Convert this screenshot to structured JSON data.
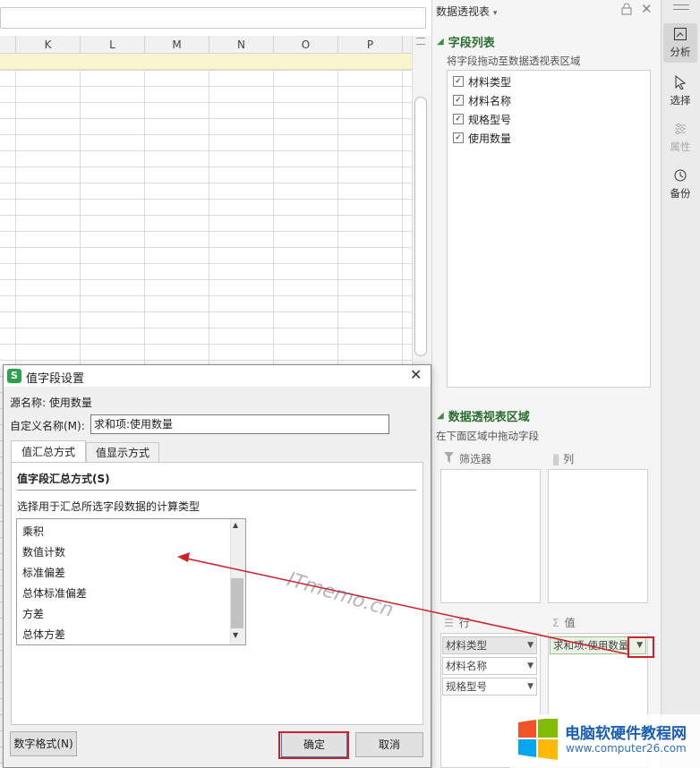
{
  "sheet": {
    "columns": [
      "K",
      "L",
      "M",
      "N",
      "O",
      "P"
    ]
  },
  "panel": {
    "title": "数据透视表",
    "title_caret": "▾",
    "field_list_title": "字段列表",
    "field_list_hint": "将字段拖动至数据透视表区域",
    "fields": [
      {
        "label": "材料类型",
        "checked": true
      },
      {
        "label": "材料名称",
        "checked": true
      },
      {
        "label": "规格型号",
        "checked": true
      },
      {
        "label": "使用数量",
        "checked": true
      }
    ],
    "areas_title": "数据透视表区域",
    "areas_hint": "在下面区域中拖动字段",
    "filter_label": "筛选器",
    "column_label": "列",
    "row_label": "行",
    "value_label": "值",
    "row_fields": [
      "材料类型",
      "材料名称",
      "规格型号"
    ],
    "value_fields": [
      "求和项:使用数量"
    ]
  },
  "toolbar": {
    "items": [
      {
        "label": "分析",
        "icon": "analyze-icon",
        "active": true
      },
      {
        "label": "选择",
        "icon": "cursor-icon",
        "active": false
      },
      {
        "label": "属性",
        "icon": "properties-icon",
        "active": false
      },
      {
        "label": "备份",
        "icon": "history-icon",
        "active": false
      }
    ]
  },
  "dialog": {
    "title": "值字段设置",
    "app_logo": "S",
    "source_name_label": "源名称: 使用数量",
    "custom_name_label": "自定义名称(M):",
    "custom_name_value": "求和项:使用数量",
    "tabs": [
      "值汇总方式",
      "值显示方式"
    ],
    "active_tab": 0,
    "section_title": "值字段汇总方式(S)",
    "list_hint": "选择用于汇总所选字段数据的计算类型",
    "calc_types": [
      "乘积",
      "数值计数",
      "标准偏差",
      "总体标准偏差",
      "方差",
      "总体方差"
    ],
    "number_format_button": "数字格式(N)",
    "ok_button": "确定",
    "cancel_button": "取消"
  },
  "overlay": {
    "watermark": "ITmemo.cn",
    "brand_text": "电脑软硬件教程网",
    "brand_url": "www.computer26.com",
    "accent_red": "#d0202a"
  }
}
